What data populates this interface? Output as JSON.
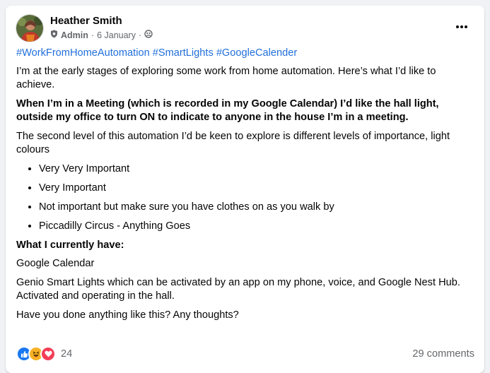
{
  "post": {
    "author": "Heather Smith",
    "role": "Admin",
    "date": "6 January",
    "separator": "·",
    "hashtags": [
      "#WorkFromHomeAutomation",
      "#SmartLights",
      "#GoogleCalender"
    ],
    "paragraph1": "I’m at the early stages of exploring some work from home automation. Here’s what I’d like to achieve.",
    "paragraph2_bold": "When I’m in a Meeting (which is recorded in my Google Calendar) I’d like the hall light, outside my office to turn ON to indicate to anyone in the house I’m in a meeting.",
    "paragraph3": "The second level of this automation I’d be keen to explore is different levels of importance, light colours",
    "list": [
      "Very Very Important",
      "Very Important",
      "Not important but make sure you have clothes on as you walk by",
      "Piccadilly Circus - Anything Goes"
    ],
    "heading_bold": "What I currently have:",
    "have1": "Google Calendar",
    "have2": "Genio Smart Lights which can be activated by an app on my phone, voice, and Google Nest Hub. Activated and operating in the hall.",
    "question": "Have you done anything like this? Any thoughts?"
  },
  "footer": {
    "reaction_count": "24",
    "comments": "29 comments"
  },
  "icons": {
    "admin_badge": "shield-icon",
    "audience": "group-icon",
    "more": "more-options-icon",
    "reactions": [
      "like-icon",
      "haha-icon",
      "love-icon"
    ]
  },
  "colors": {
    "link": "#216fdb",
    "like": "#1877f2",
    "love": "#f33e58",
    "haha": "#f7b125",
    "secondary_text": "#65676b"
  }
}
